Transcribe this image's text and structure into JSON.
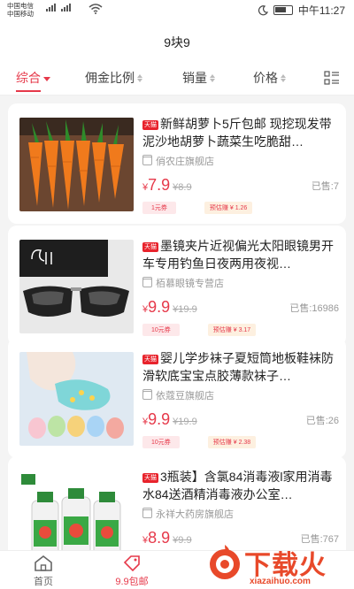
{
  "status_bar": {
    "carrier1": "中国电信",
    "carrier2": "中国移动",
    "net1": "4G",
    "net2": "4G",
    "time": "中午11:27"
  },
  "header": {
    "title": "9块9"
  },
  "sort_bar": {
    "items": [
      {
        "label": "综合"
      },
      {
        "label": "佣金比例"
      },
      {
        "label": "销量"
      },
      {
        "label": "价格"
      }
    ]
  },
  "products": [
    {
      "badge": "天猫",
      "title": "新鲜胡萝卜5斤包邮 现挖现发带泥沙地胡萝卜蔬菜生吃脆甜…",
      "shop": "俏农庄旗舰店",
      "currency": "¥",
      "price": "7.9",
      "original": "¥8.9",
      "sold": "已售:7",
      "coupon": "1元券",
      "earn": "预估赚 ¥ 1.26"
    },
    {
      "badge": "天猫",
      "title": "墨镜夹片近视偏光太阳眼镜男开车专用钓鱼日夜两用夜视…",
      "shop": "栢慕眼镜专营店",
      "currency": "¥",
      "price": "9.9",
      "original": "¥19.9",
      "sold": "已售:16986",
      "coupon": "10元券",
      "earn": "预估赚 ¥ 3.17"
    },
    {
      "badge": "天猫",
      "title": "婴儿学步袜子夏短筒地板鞋袜防滑软底宝宝点胶薄款袜子…",
      "shop": "依蔻豆旗舰店",
      "currency": "¥",
      "price": "9.9",
      "original": "¥19.9",
      "sold": "已售:26",
      "coupon": "10元券",
      "earn": "预估赚 ¥ 2.38"
    },
    {
      "badge": "天猫",
      "title": "3瓶装】含氯84消毒液l家用消毒水84送酒精消毒液办公室…",
      "shop": "永祥大药房旗舰店",
      "currency": "¥",
      "price": "8.9",
      "original": "¥9.9",
      "sold": "已售:767",
      "coupon": "",
      "earn": ""
    }
  ],
  "tab_bar": {
    "home": "首页",
    "deals": "9.9包邮"
  },
  "watermark": {
    "text": "下载火",
    "url": "xiazaihuo.com"
  },
  "colors": {
    "accent": "#e6394a",
    "background": "#f4f4f4"
  }
}
